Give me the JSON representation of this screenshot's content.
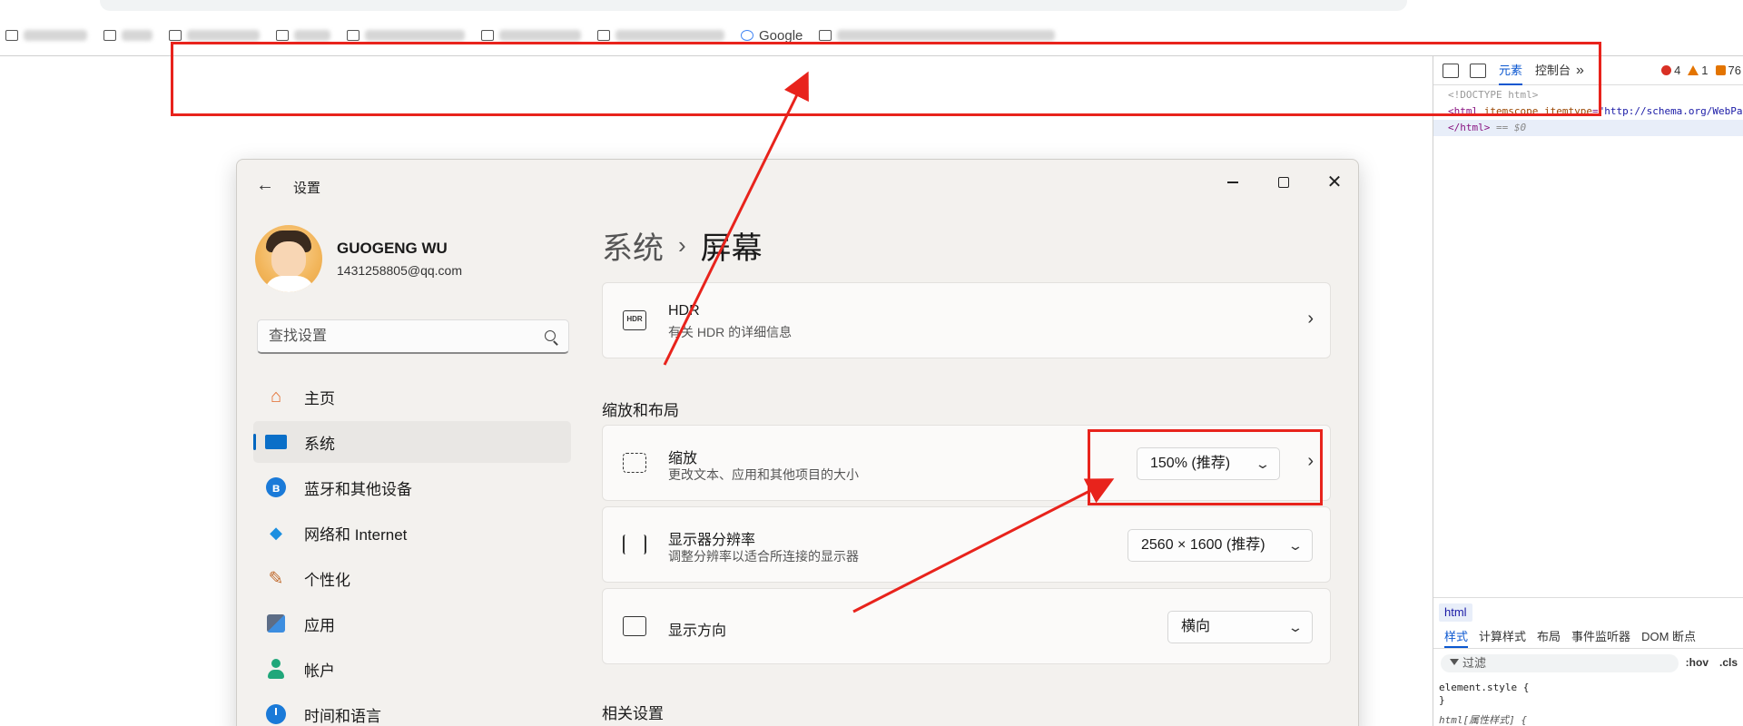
{
  "browser": {
    "bookmarks": [
      {
        "label": "已阅业务",
        "blurred": true
      },
      {
        "label": "",
        "blurred": true
      },
      {
        "label": "",
        "blurred": true
      },
      {
        "label": "",
        "blurred": true
      },
      {
        "label": "",
        "blurred": true
      },
      {
        "label": "",
        "blurred": true
      },
      {
        "label": "",
        "blurred": true
      },
      {
        "label": "Google",
        "blurred": false
      },
      {
        "label": "",
        "blurred": true
      }
    ]
  },
  "settings": {
    "window_title": "设置",
    "user": {
      "name": "GUOGENG WU",
      "email": "1431258805@qq.com"
    },
    "search": {
      "placeholder": "查找设置"
    },
    "nav": [
      {
        "label": "主页",
        "icon": "home-icon"
      },
      {
        "label": "系统",
        "icon": "system-icon",
        "active": true
      },
      {
        "label": "蓝牙和其他设备",
        "icon": "bluetooth-icon"
      },
      {
        "label": "网络和 Internet",
        "icon": "network-icon"
      },
      {
        "label": "个性化",
        "icon": "brush-icon"
      },
      {
        "label": "应用",
        "icon": "apps-icon"
      },
      {
        "label": "帐户",
        "icon": "account-icon"
      },
      {
        "label": "时间和语言",
        "icon": "time-language-icon"
      }
    ],
    "breadcrumb": {
      "parent": "系统",
      "separator": "›",
      "current": "屏幕"
    },
    "hdr": {
      "title": "HDR",
      "subtitle": "有关 HDR 的详细信息",
      "icon_text": "HDR"
    },
    "scale_layout_section": "缩放和布局",
    "scale": {
      "title": "缩放",
      "subtitle": "更改文本、应用和其他项目的大小",
      "value": "150% (推荐)"
    },
    "resolution": {
      "title": "显示器分辨率",
      "subtitle": "调整分辨率以适合所连接的显示器",
      "value": "2560 × 1600 (推荐)"
    },
    "orientation": {
      "title": "显示方向",
      "value": "横向"
    },
    "related_section": "相关设置"
  },
  "devtools": {
    "tabs": [
      "元素",
      "控制台"
    ],
    "active_tab": "元素",
    "counts": {
      "errors": "4",
      "warnings": "1",
      "info": "76"
    },
    "dom": {
      "doctype": "<!DOCTYPE html>",
      "html_open_tag": "<html",
      "attr1_name": "itemscope",
      "attr2_name": "itemtype",
      "attr2_value": "\"http://schema.org/WebPage\"",
      "html_close": "</html>",
      "selected_marker": "== $0"
    },
    "breadcrumb": "html",
    "style_tabs": [
      "样式",
      "计算样式",
      "布局",
      "事件监听器",
      "DOM 断点"
    ],
    "filter_placeholder": "过滤",
    "hov": ":hov",
    "cls": ".cls",
    "rules": [
      "element.style {",
      "}",
      "html[属性样式] {"
    ]
  },
  "annotation_color": "#e8231c"
}
